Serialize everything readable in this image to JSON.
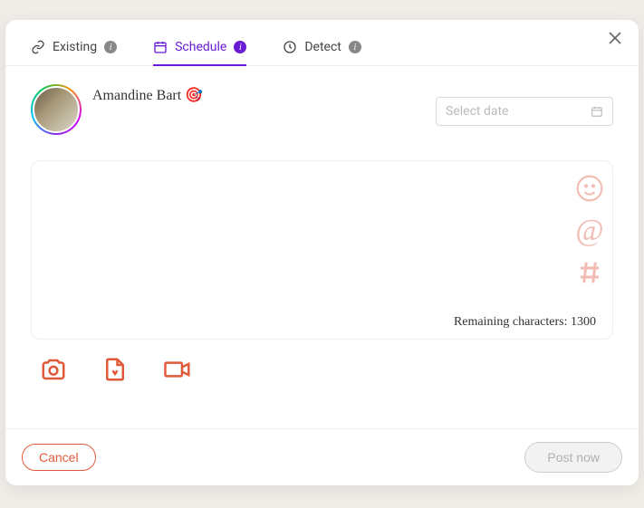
{
  "tabs": {
    "existing": "Existing",
    "schedule": "Schedule",
    "detect": "Detect"
  },
  "user": {
    "name": "Amandine Bart 🎯"
  },
  "date_picker": {
    "placeholder": "Select date"
  },
  "composer": {
    "remaining_label": "Remaining characters: ",
    "remaining_count": "1300"
  },
  "buttons": {
    "cancel": "Cancel",
    "post": "Post now"
  }
}
